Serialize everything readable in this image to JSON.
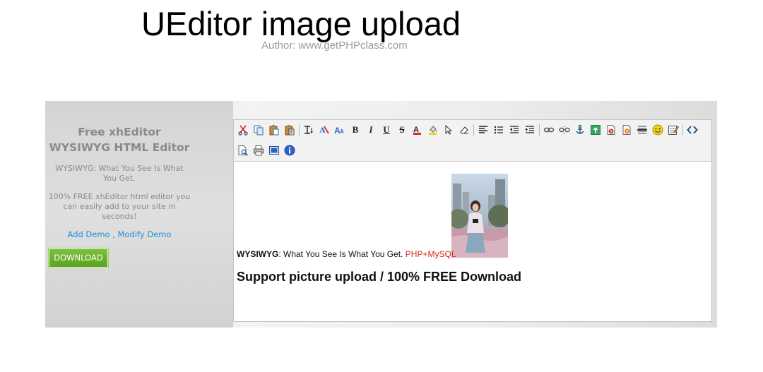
{
  "page": {
    "title": "UEditor image upload",
    "author": "Author: www.getPHPclass.com"
  },
  "sidebar": {
    "title_line1": "Free xhEditor",
    "title_line2": "WYSIWYG HTML Editor",
    "desc1_line1": "WYSIWYG: What You See Is What",
    "desc1_line2": "You Get.",
    "desc2_line1": "100% FREE xhEditor html editor you",
    "desc2_line2": "can easily add to your site in",
    "desc2_line3": "seconds!",
    "link_add": "Add Demo",
    "link_sep": " , ",
    "link_modify": "Modify Demo",
    "download": "DOWNLOAD"
  },
  "toolbar": {
    "bold": "B",
    "italic": "I",
    "underline": "U",
    "strike": "S",
    "fontcolor": "A",
    "row1_icons": [
      "cut-icon",
      "copy-icon",
      "paste-icon",
      "paste-text-icon",
      "block-format-icon",
      "font-family-icon",
      "font-size-icon",
      "bold-icon",
      "italic-icon",
      "underline-icon",
      "strikethrough-icon",
      "font-color-icon",
      "background-color-icon",
      "select-all-icon",
      "remove-format-icon",
      "align-icon",
      "list-icon",
      "outdent-icon",
      "indent-icon",
      "link-icon",
      "unlink-icon",
      "anchor-icon",
      "image-icon",
      "flash-icon",
      "media-icon",
      "horizontal-rule-icon",
      "emoticon-icon",
      "table-icon",
      "source-icon"
    ],
    "row2_icons": [
      "preview-icon",
      "print-icon",
      "fullscreen-icon",
      "about-icon"
    ]
  },
  "content": {
    "wysiwyg": "WYSIWYG",
    "text1": ": What You See Is What You Get. ",
    "php": "PHP+MySQL",
    "text2": "Support picture upload / 100% FREE Download"
  }
}
